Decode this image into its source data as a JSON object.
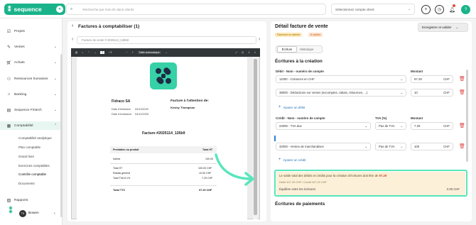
{
  "topbar": {
    "brand": "sequence",
    "search_placeholder": "Recherche par mot-clé dans clients",
    "company_select": "Sélectionnez compte client"
  },
  "sidebar": {
    "items": [
      {
        "label": "Projets",
        "icon": "check-square-icon"
      },
      {
        "label": "Ventes",
        "icon": "pencil-icon"
      },
      {
        "label": "Achats",
        "icon": "cart-icon"
      },
      {
        "label": "Ressources humaines",
        "icon": "people-icon"
      },
      {
        "label": "Banking",
        "icon": "bank-icon"
      },
      {
        "label": "Sequence Fintech",
        "icon": "fintech-icon"
      },
      {
        "label": "Comptabilité",
        "icon": "ledger-icon"
      }
    ],
    "subitems": [
      "Comptabilité analytique",
      "Plan comptable",
      "Grand livre",
      "Exercices comptables",
      "Contrôle comptable",
      "Documents"
    ],
    "reports": "Rapports",
    "user": "Bowen",
    "badge": "TS"
  },
  "left": {
    "title": "Factures à comptabiliser (1)",
    "file": "Facture de vente # 2025114_126b9",
    "viewer": {
      "page": "1",
      "pages": "/ 2",
      "zoom": "Taille automatique"
    },
    "invoice": {
      "company": "Fidraco SA",
      "attention": "Facture à l'attention de:",
      "client": "Kesley Thompson",
      "emis_label": "Date d'émission",
      "emis": "04/11/2025",
      "ech_label": "Date d'échéance",
      "ech": "04/12/2025",
      "number": "Facture #2025114_126b9",
      "col1": "Prestation ou produit",
      "col2": "Total HT",
      "line_item": "harhar",
      "line_amount": "100.00",
      "total_ht_label": "Total HT",
      "total_ht": "100.00 CHF",
      "rabais_label": "Rabais général",
      "rabais": "10.00 CHF",
      "tva_label": "Total TVA 8.1%",
      "tva": "7.29 CHF",
      "ttc_label": "Total TTC",
      "ttc": "97.29 CHF"
    }
  },
  "right": {
    "title": "Détail facture de vente",
    "badge1": "Paiement en attente",
    "badge2": "À valider",
    "save": "Enregistrer et valider",
    "tabs": [
      "Écriture",
      "Historique"
    ],
    "section_creation": "Écritures à la création",
    "debit_label": "Débit - Nom - numéro de compte",
    "montant_label": "Montant",
    "debits": [
      {
        "account": "11000 - Créances en CHF",
        "amount": "97.29",
        "currency": "CHF"
      },
      {
        "account": "38000 - Déductions sur ventes (escomptes, rabais, ristournes, ...)",
        "amount": "10",
        "currency": "CHF"
      }
    ],
    "add_debit": "Ajouter un débit",
    "credit_label": "Crédit - Nom - numéro de compte",
    "tva_col": "TVA (%)",
    "credits": [
      {
        "account": "22000 - TVA due",
        "tva": "Pas de TVA",
        "amount": "7.29",
        "currency": "CHF"
      },
      {
        "account": "32000 - Ventes de marchandises",
        "tva": "Pas de TVA",
        "amount": "100",
        "currency": "CHF"
      }
    ],
    "add_credit": "Ajouter un crédit",
    "notice": {
      "text": "Le solde total des débits et crédits pour la création d'écritures doit être de",
      "value": "97.29",
      "detail": "Débit 107.29 CHF / Crédit 107.29 CHF",
      "equil_label": "Équilibre entre les écritures:",
      "equil_value": "0.00 CHF"
    },
    "section_payments": "Écritures de paiements"
  }
}
